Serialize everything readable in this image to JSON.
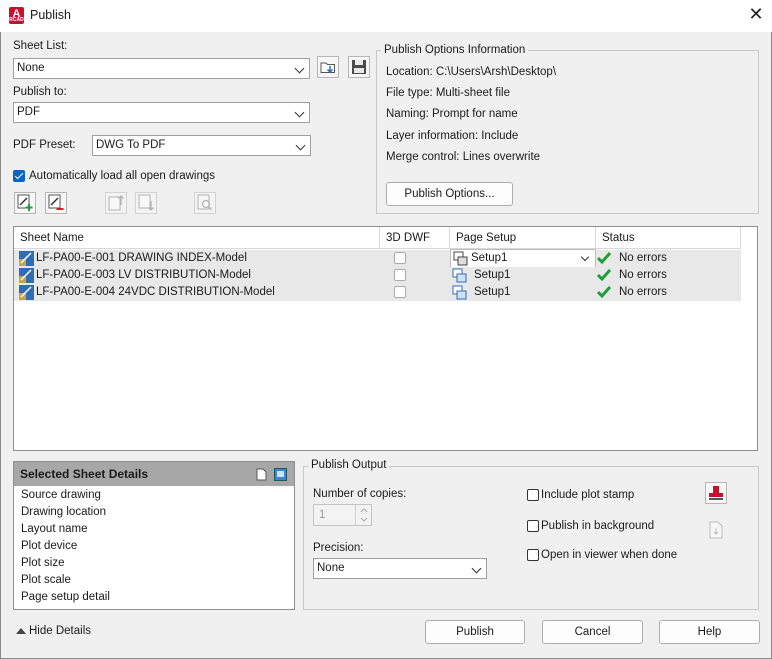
{
  "window": {
    "app_icon_letter": "A",
    "app_icon_sub": "RCAD",
    "title": "Publish",
    "close_glyph": "✕"
  },
  "sheet_list": {
    "label": "Sheet List:",
    "value": "None"
  },
  "publish_to": {
    "label": "Publish to:",
    "value": "PDF"
  },
  "pdf_preset": {
    "label": "PDF Preset:",
    "value": "DWG To PDF"
  },
  "auto_load": {
    "label": "Automatically load all open drawings",
    "checked": true
  },
  "publish_options_info": {
    "title": "Publish Options Information",
    "location": "Location: C:\\Users\\Arsh\\Desktop\\",
    "file_type": "File type: Multi-sheet file",
    "naming": "Naming: Prompt for name",
    "layer_info": "Layer information: Include",
    "merge_control": "Merge control: Lines overwrite",
    "button": "Publish Options..."
  },
  "table": {
    "columns": [
      "Sheet Name",
      "3D DWF",
      "Page Setup",
      "Status"
    ],
    "rows": [
      {
        "sheet_name": "LF-PA00-E-001 DRAWING INDEX-Model",
        "page_setup": "Setup1",
        "status": "No errors"
      },
      {
        "sheet_name": "LF-PA00-E-003 LV DISTRIBUTION-Model",
        "page_setup": "Setup1",
        "status": "No errors"
      },
      {
        "sheet_name": "LF-PA00-E-004 24VDC DISTRIBUTION-Model",
        "page_setup": "Setup1",
        "status": "No errors"
      }
    ]
  },
  "selected_sheet_details": {
    "title": "Selected Sheet Details",
    "items": [
      "Source drawing",
      "Drawing location",
      "Layout name",
      "Plot device",
      "Plot size",
      "Plot scale",
      "Page setup detail"
    ]
  },
  "publish_output": {
    "title": "Publish Output",
    "copies_label": "Number of copies:",
    "copies_value": "1",
    "precision_label": "Precision:",
    "precision_value": "None",
    "include_plot_stamp": "Include plot stamp",
    "publish_in_background": "Publish in background",
    "open_in_viewer": "Open in viewer when done"
  },
  "footer": {
    "hide_details": "Hide Details",
    "publish": "Publish",
    "cancel": "Cancel",
    "help": "Help"
  },
  "colors": {
    "accent_blue": "#0a64c8",
    "status_green": "#1f9d3a",
    "autocad_red": "#c8102e"
  }
}
